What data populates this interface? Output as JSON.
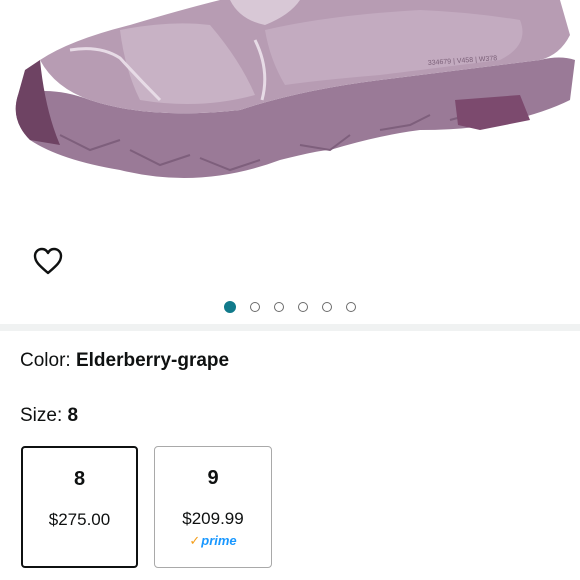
{
  "gallery": {
    "image_alt": "Shoe product image",
    "sole_text": "334679 | V458 | W378",
    "dots_count": 6,
    "active_index": 0
  },
  "color": {
    "label": "Color:",
    "value": "Elderberry-grape"
  },
  "size": {
    "label": "Size:",
    "value": "8"
  },
  "size_options": [
    {
      "size": "8",
      "price": "$275.00",
      "prime": ""
    },
    {
      "size": "9",
      "price": "$209.99",
      "prime": "prime"
    }
  ],
  "colors": {
    "accent": "#117a8b",
    "prime": "#1a98ff",
    "prime_check": "#f49e1b",
    "shoe": "#a78aa3"
  }
}
